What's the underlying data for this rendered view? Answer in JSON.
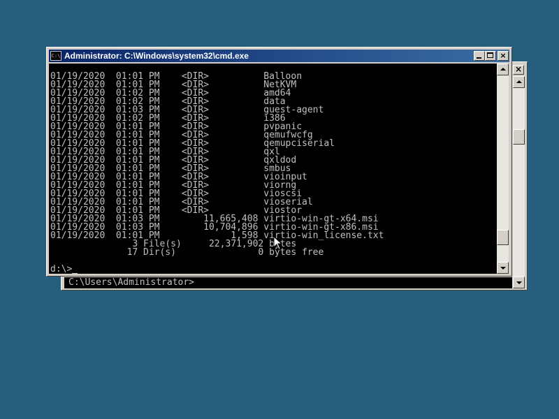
{
  "desktop": {
    "background_color": "#255f7d"
  },
  "back_window": {
    "close_glyph": "×",
    "prompt": "C:\\Users\\Administrator>"
  },
  "window": {
    "icon_text": "C:\\",
    "title": "Administrator: C:\\Windows\\system32\\cmd.exe",
    "titlebar_color": "#0a246a",
    "console_bg": "#000000",
    "console_fg": "#c0c0c0"
  },
  "console": {
    "lines": [
      "01/19/2020  01:01 PM    <DIR>          Balloon",
      "01/19/2020  01:01 PM    <DIR>          NetKVM",
      "01/19/2020  01:02 PM    <DIR>          amd64",
      "01/19/2020  01:02 PM    <DIR>          data",
      "01/19/2020  01:03 PM    <DIR>          guest-agent",
      "01/19/2020  01:02 PM    <DIR>          i386",
      "01/19/2020  01:01 PM    <DIR>          pvpanic",
      "01/19/2020  01:01 PM    <DIR>          qemufwcfg",
      "01/19/2020  01:01 PM    <DIR>          qemupciserial",
      "01/19/2020  01:01 PM    <DIR>          qxl",
      "01/19/2020  01:01 PM    <DIR>          qxldod",
      "01/19/2020  01:01 PM    <DIR>          smbus",
      "01/19/2020  01:01 PM    <DIR>          vioinput",
      "01/19/2020  01:01 PM    <DIR>          viorng",
      "01/19/2020  01:01 PM    <DIR>          vioscsi",
      "01/19/2020  01:01 PM    <DIR>          vioserial",
      "01/19/2020  01:01 PM    <DIR>          viostor",
      "01/19/2020  01:03 PM        11,665,408 virtio-win-gt-x64.msi",
      "01/19/2020  01:03 PM        10,704,896 virtio-win-gt-x86.msi",
      "01/19/2020  01:01 PM             1,598 virtio-win_license.txt",
      "               3 File(s)     22,371,902 bytes",
      "              17 Dir(s)               0 bytes free",
      "",
      "d:\\>"
    ]
  },
  "scrollbar": {
    "position_fraction": 0.9
  }
}
